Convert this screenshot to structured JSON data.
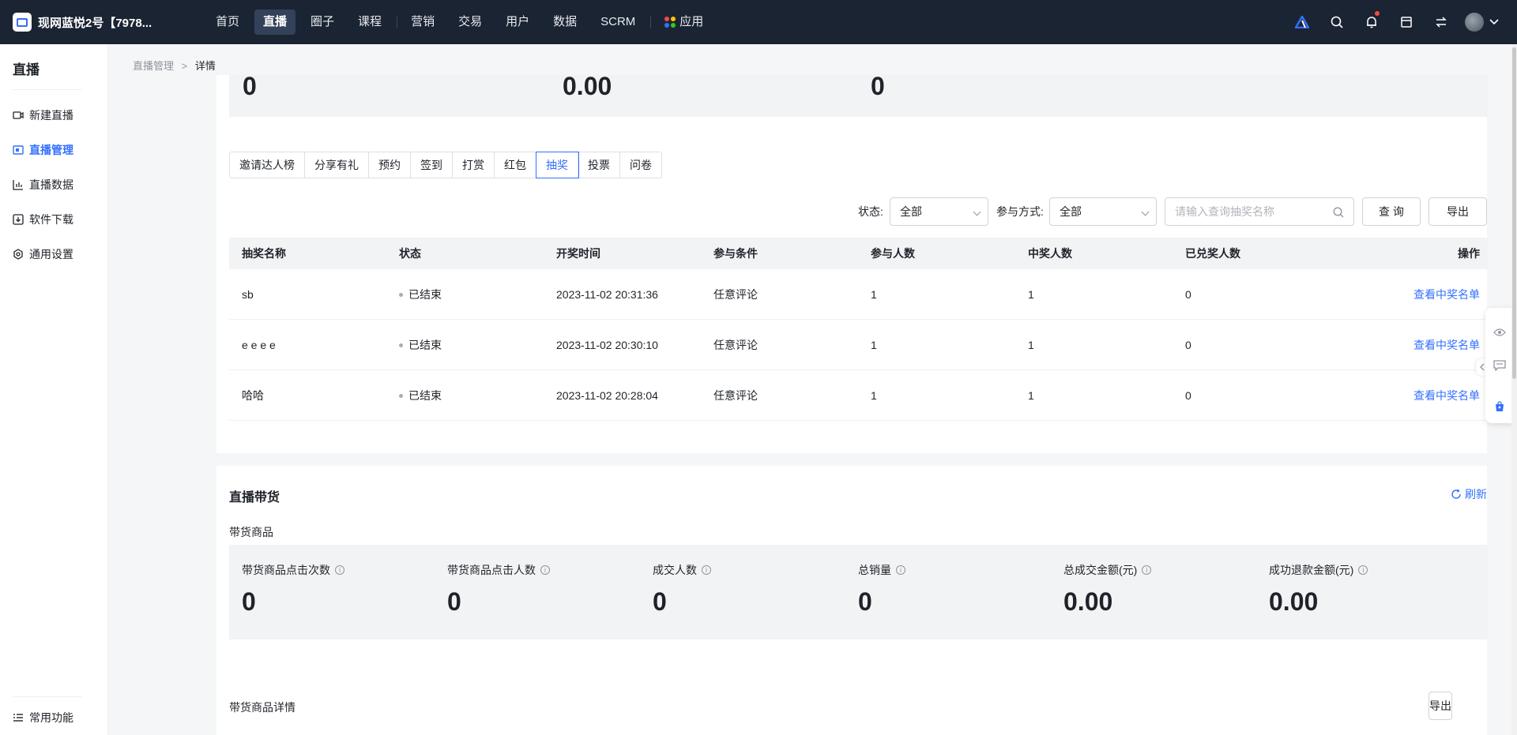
{
  "topbar": {
    "brand": "现网蓝悦2号【7978...",
    "nav": [
      {
        "label": "首页",
        "active": false
      },
      {
        "label": "直播",
        "active": true
      },
      {
        "label": "圈子",
        "active": false
      },
      {
        "label": "课程",
        "active": false
      },
      {
        "label": "营销",
        "active": false
      },
      {
        "label": "交易",
        "active": false
      },
      {
        "label": "用户",
        "active": false
      },
      {
        "label": "数据",
        "active": false
      },
      {
        "label": "SCRM",
        "active": false
      },
      {
        "label": "应用",
        "active": false
      }
    ],
    "icons": [
      "triangle-logo-icon",
      "search-icon",
      "bell-icon",
      "store-icon",
      "switch-icon",
      "avatar",
      "chevron-down-icon"
    ]
  },
  "sidebar": {
    "title": "直播",
    "items": [
      {
        "label": "新建直播",
        "icon": "new-live-icon",
        "active": false
      },
      {
        "label": "直播管理",
        "icon": "live-manage-icon",
        "active": true
      },
      {
        "label": "直播数据",
        "icon": "live-data-icon",
        "active": false
      },
      {
        "label": "软件下载",
        "icon": "download-icon",
        "active": false
      },
      {
        "label": "通用设置",
        "icon": "gear-icon",
        "active": false
      }
    ],
    "bottom": "常用功能"
  },
  "breadcrumb": {
    "parent": "直播管理",
    "sep": ">",
    "current": "详情"
  },
  "top_stats": [
    "0",
    "0.00",
    "0"
  ],
  "tabs": [
    {
      "label": "邀请达人榜",
      "active": false
    },
    {
      "label": "分享有礼",
      "active": false
    },
    {
      "label": "预约",
      "active": false
    },
    {
      "label": "签到",
      "active": false
    },
    {
      "label": "打赏",
      "active": false
    },
    {
      "label": "红包",
      "active": false
    },
    {
      "label": "抽奖",
      "active": true
    },
    {
      "label": "投票",
      "active": false
    },
    {
      "label": "问卷",
      "active": false
    }
  ],
  "filters": {
    "status_label": "状态:",
    "status_value": "全部",
    "mode_label": "参与方式:",
    "mode_value": "全部",
    "search_placeholder": "请输入查询抽奖名称",
    "query_button": "查 询",
    "export_button": "导出"
  },
  "table": {
    "headers": [
      "抽奖名称",
      "状态",
      "开奖时间",
      "参与条件",
      "参与人数",
      "中奖人数",
      "已兑奖人数",
      "操作"
    ],
    "rows": [
      {
        "name": "sb",
        "status": "已结束",
        "time": "2023-11-02 20:31:36",
        "condition": "任意评论",
        "participants": "1",
        "winners": "1",
        "redeemed": "0",
        "action": "查看中奖名单"
      },
      {
        "name": "e e e e",
        "status": "已结束",
        "time": "2023-11-02 20:30:10",
        "condition": "任意评论",
        "participants": "1",
        "winners": "1",
        "redeemed": "0",
        "action": "查看中奖名单"
      },
      {
        "name": "哈哈",
        "status": "已结束",
        "time": "2023-11-02 20:28:04",
        "condition": "任意评论",
        "participants": "1",
        "winners": "1",
        "redeemed": "0",
        "action": "查看中奖名单"
      }
    ]
  },
  "goods": {
    "title": "直播带货",
    "refresh": "刷新",
    "subtitle": "带货商品",
    "stats": [
      {
        "label": "带货商品点击次数",
        "value": "0"
      },
      {
        "label": "带货商品点击人数",
        "value": "0"
      },
      {
        "label": "成交人数",
        "value": "0"
      },
      {
        "label": "总销量",
        "value": "0"
      },
      {
        "label": "总成交金额(元)",
        "value": "0.00"
      },
      {
        "label": "成功退款金额(元)",
        "value": "0.00"
      }
    ],
    "detail_title": "带货商品详情",
    "export_button": "导出"
  },
  "colors": {
    "accent": "#3370ff",
    "topbar": "#1b2433",
    "stat_bg": "#f2f3f5"
  }
}
